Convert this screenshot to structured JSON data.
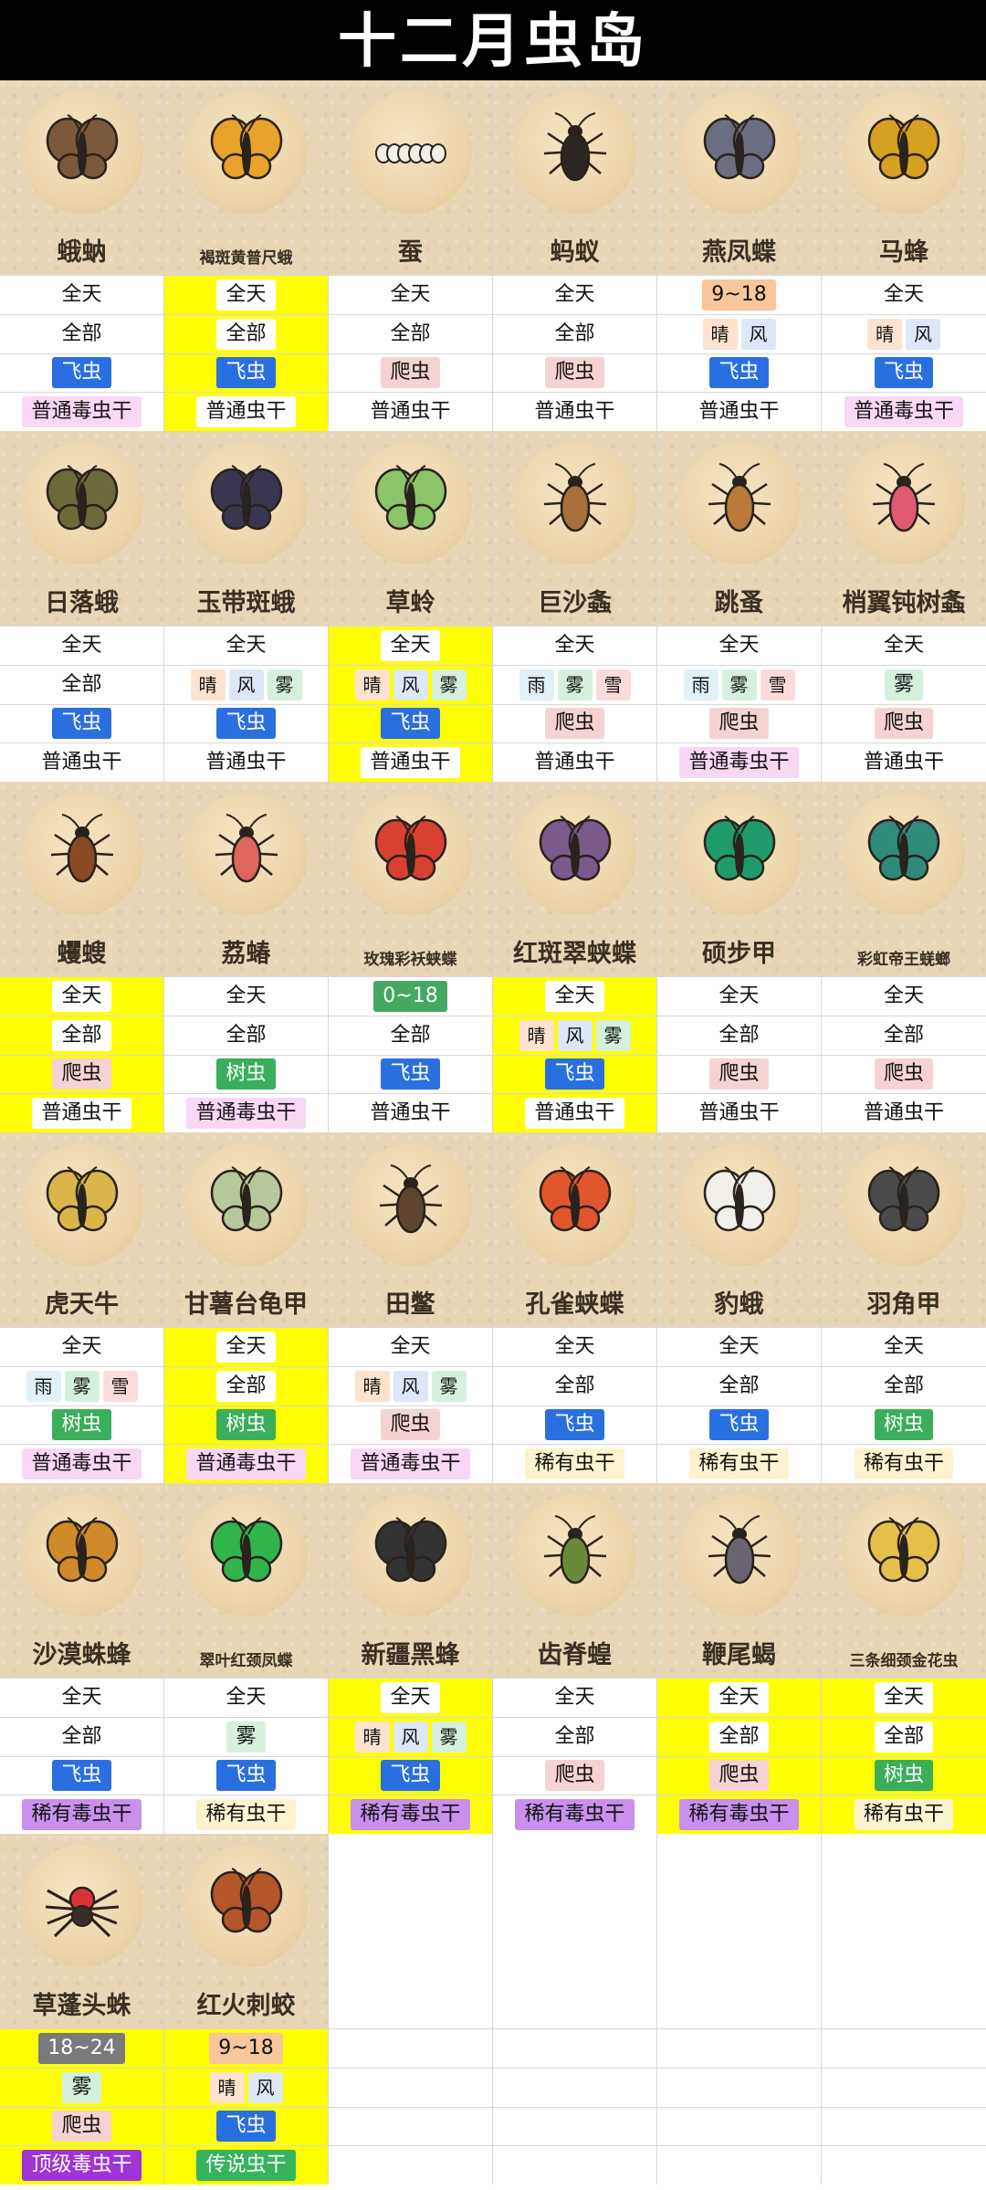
{
  "title": "十二月虫岛",
  "bugs": [
    {
      "name": "蛾蚋",
      "time": "全天",
      "weather": [
        {
          "label": "全部",
          "kind": "all"
        }
      ],
      "type": {
        "label": "飞虫",
        "kind": "fly"
      },
      "reward": {
        "label": "普通毒虫干",
        "kind": "ptox"
      },
      "highlight": false,
      "icon": "moth-fly-icon",
      "color": "#7a5a3a",
      "small": false
    },
    {
      "name": "褐斑黄普尺蛾",
      "time": "全天",
      "weather": [
        {
          "label": "全部",
          "kind": "all"
        }
      ],
      "type": {
        "label": "飞虫",
        "kind": "fly"
      },
      "reward": {
        "label": "普通虫干",
        "kind": "plain"
      },
      "highlight": true,
      "icon": "geometer-moth-icon",
      "color": "#e9a22a",
      "small": true
    },
    {
      "name": "蚕",
      "time": "全天",
      "weather": [
        {
          "label": "全部",
          "kind": "all"
        }
      ],
      "type": {
        "label": "爬虫",
        "kind": "crawl"
      },
      "reward": {
        "label": "普通虫干",
        "kind": "plain"
      },
      "highlight": false,
      "icon": "silkworm-icon",
      "color": "#f2efe6",
      "small": false
    },
    {
      "name": "蚂蚁",
      "time": "全天",
      "weather": [
        {
          "label": "全部",
          "kind": "all"
        }
      ],
      "type": {
        "label": "爬虫",
        "kind": "crawl"
      },
      "reward": {
        "label": "普通虫干",
        "kind": "plain"
      },
      "highlight": false,
      "icon": "ant-icon",
      "color": "#2b2622",
      "small": false
    },
    {
      "name": "燕凤蝶",
      "time": "9~18",
      "timeKind": "or",
      "weather": [
        {
          "label": "晴",
          "kind": "sun"
        },
        {
          "label": "风",
          "kind": "wind"
        }
      ],
      "type": {
        "label": "飞虫",
        "kind": "fly"
      },
      "reward": {
        "label": "普通虫干",
        "kind": "plain"
      },
      "highlight": false,
      "icon": "swallowtail-butterfly-icon",
      "color": "#6b6e80",
      "small": false
    },
    {
      "name": "马蜂",
      "time": "全天",
      "weather": [
        {
          "label": "晴",
          "kind": "sun"
        },
        {
          "label": "风",
          "kind": "wind"
        }
      ],
      "type": {
        "label": "飞虫",
        "kind": "fly"
      },
      "reward": {
        "label": "普通毒虫干",
        "kind": "ptox"
      },
      "highlight": false,
      "icon": "wasp-icon",
      "color": "#d6a021",
      "small": false
    },
    {
      "name": "日落蛾",
      "time": "全天",
      "weather": [
        {
          "label": "全部",
          "kind": "all"
        }
      ],
      "type": {
        "label": "飞虫",
        "kind": "fly"
      },
      "reward": {
        "label": "普通虫干",
        "kind": "plain"
      },
      "highlight": false,
      "icon": "sunset-moth-icon",
      "color": "#6b6a3a",
      "small": false
    },
    {
      "name": "玉带斑蛾",
      "time": "全天",
      "weather": [
        {
          "label": "晴",
          "kind": "sun"
        },
        {
          "label": "风",
          "kind": "wind"
        },
        {
          "label": "雾",
          "kind": "fog"
        }
      ],
      "type": {
        "label": "飞虫",
        "kind": "fly"
      },
      "reward": {
        "label": "普通虫干",
        "kind": "plain"
      },
      "highlight": false,
      "icon": "burnet-moth-icon",
      "color": "#3b3650",
      "small": false
    },
    {
      "name": "草蛉",
      "time": "全天",
      "weather": [
        {
          "label": "晴",
          "kind": "sun"
        },
        {
          "label": "风",
          "kind": "wind"
        },
        {
          "label": "雾",
          "kind": "fog"
        }
      ],
      "type": {
        "label": "飞虫",
        "kind": "fly"
      },
      "reward": {
        "label": "普通虫干",
        "kind": "plain"
      },
      "highlight": true,
      "icon": "lacewing-icon",
      "color": "#8cc46a",
      "small": false
    },
    {
      "name": "巨沙螽",
      "time": "全天",
      "weather": [
        {
          "label": "雨",
          "kind": "rain"
        },
        {
          "label": "雾",
          "kind": "fog"
        },
        {
          "label": "雪",
          "kind": "snow"
        }
      ],
      "type": {
        "label": "爬虫",
        "kind": "crawl"
      },
      "reward": {
        "label": "普通虫干",
        "kind": "plain"
      },
      "highlight": false,
      "icon": "sand-cricket-icon",
      "color": "#a8703a",
      "small": false
    },
    {
      "name": "跳蚤",
      "time": "全天",
      "weather": [
        {
          "label": "雨",
          "kind": "rain"
        },
        {
          "label": "雾",
          "kind": "fog"
        },
        {
          "label": "雪",
          "kind": "snow"
        }
      ],
      "type": {
        "label": "爬虫",
        "kind": "crawl"
      },
      "reward": {
        "label": "普通毒虫干",
        "kind": "ptox"
      },
      "highlight": false,
      "icon": "flea-icon",
      "color": "#b97a3c",
      "small": false
    },
    {
      "name": "梢翼钝树螽",
      "time": "全天",
      "weather": [
        {
          "label": "雾",
          "kind": "fog"
        }
      ],
      "type": {
        "label": "爬虫",
        "kind": "crawl"
      },
      "reward": {
        "label": "普通虫干",
        "kind": "plain"
      },
      "highlight": false,
      "icon": "katydid-icon",
      "color": "#e25a72",
      "small": false
    },
    {
      "name": "蠼螋",
      "time": "全天",
      "weather": [
        {
          "label": "全部",
          "kind": "all"
        }
      ],
      "type": {
        "label": "爬虫",
        "kind": "crawl"
      },
      "reward": {
        "label": "普通虫干",
        "kind": "plain"
      },
      "highlight": true,
      "icon": "earwig-icon",
      "color": "#8a4a24",
      "small": false
    },
    {
      "name": "荔蝽",
      "time": "全天",
      "weather": [
        {
          "label": "全部",
          "kind": "all"
        }
      ],
      "type": {
        "label": "树虫",
        "kind": "tree"
      },
      "reward": {
        "label": "普通毒虫干",
        "kind": "ptox"
      },
      "highlight": false,
      "icon": "stink-bug-icon",
      "color": "#e0655c",
      "small": false
    },
    {
      "name": "玫瑰彩袄蛱蝶",
      "time": "0~18",
      "timeKind": "gr",
      "weather": [
        {
          "label": "全部",
          "kind": "all"
        }
      ],
      "type": {
        "label": "飞虫",
        "kind": "fly"
      },
      "reward": {
        "label": "普通虫干",
        "kind": "plain"
      },
      "highlight": false,
      "icon": "rose-butterfly-icon",
      "color": "#d8402f",
      "small": true
    },
    {
      "name": "红斑翠蛱蝶",
      "time": "全天",
      "weather": [
        {
          "label": "晴",
          "kind": "sun"
        },
        {
          "label": "风",
          "kind": "wind"
        },
        {
          "label": "雾",
          "kind": "fog"
        }
      ],
      "type": {
        "label": "飞虫",
        "kind": "fly"
      },
      "reward": {
        "label": "普通虫干",
        "kind": "plain"
      },
      "highlight": true,
      "icon": "admiral-butterfly-icon",
      "color": "#7a5a8a",
      "small": false
    },
    {
      "name": "硕步甲",
      "time": "全天",
      "weather": [
        {
          "label": "全部",
          "kind": "all"
        }
      ],
      "type": {
        "label": "爬虫",
        "kind": "crawl"
      },
      "reward": {
        "label": "普通虫干",
        "kind": "plain"
      },
      "highlight": false,
      "icon": "ground-beetle-icon",
      "color": "#1f9a6a",
      "small": false
    },
    {
      "name": "彩虹帝王蜣螂",
      "time": "全天",
      "weather": [
        {
          "label": "全部",
          "kind": "all"
        }
      ],
      "type": {
        "label": "爬虫",
        "kind": "crawl"
      },
      "reward": {
        "label": "普通虫干",
        "kind": "plain"
      },
      "highlight": false,
      "icon": "dung-beetle-icon",
      "color": "#2f8a7a",
      "small": true
    },
    {
      "name": "虎天牛",
      "time": "全天",
      "weather": [
        {
          "label": "雨",
          "kind": "rain"
        },
        {
          "label": "雾",
          "kind": "fog"
        },
        {
          "label": "雪",
          "kind": "snow"
        }
      ],
      "type": {
        "label": "树虫",
        "kind": "tree"
      },
      "reward": {
        "label": "普通毒虫干",
        "kind": "ptox"
      },
      "highlight": false,
      "icon": "longhorn-beetle-icon",
      "color": "#d9b64a",
      "small": false
    },
    {
      "name": "甘薯台龟甲",
      "time": "全天",
      "weather": [
        {
          "label": "全部",
          "kind": "all"
        }
      ],
      "type": {
        "label": "树虫",
        "kind": "tree"
      },
      "reward": {
        "label": "普通毒虫干",
        "kind": "ptox"
      },
      "highlight": true,
      "icon": "tortoise-beetle-icon",
      "color": "#b7c89a",
      "small": false
    },
    {
      "name": "田鳖",
      "time": "全天",
      "weather": [
        {
          "label": "晴",
          "kind": "sun"
        },
        {
          "label": "风",
          "kind": "wind"
        },
        {
          "label": "雾",
          "kind": "fog"
        }
      ],
      "type": {
        "label": "爬虫",
        "kind": "crawl"
      },
      "reward": {
        "label": "普通毒虫干",
        "kind": "ptox"
      },
      "highlight": false,
      "icon": "water-bug-icon",
      "color": "#5e4530",
      "small": false
    },
    {
      "name": "孔雀蛱蝶",
      "time": "全天",
      "weather": [
        {
          "label": "全部",
          "kind": "all"
        }
      ],
      "type": {
        "label": "飞虫",
        "kind": "fly"
      },
      "reward": {
        "label": "稀有虫干",
        "kind": "rare"
      },
      "highlight": false,
      "icon": "peacock-butterfly-icon",
      "color": "#e0552b",
      "small": false
    },
    {
      "name": "豹蛾",
      "time": "全天",
      "weather": [
        {
          "label": "全部",
          "kind": "all"
        }
      ],
      "type": {
        "label": "飞虫",
        "kind": "fly"
      },
      "reward": {
        "label": "稀有虫干",
        "kind": "rare"
      },
      "highlight": false,
      "icon": "leopard-moth-icon",
      "color": "#f1efe9",
      "small": false
    },
    {
      "name": "羽角甲",
      "time": "全天",
      "weather": [
        {
          "label": "全部",
          "kind": "all"
        }
      ],
      "type": {
        "label": "树虫",
        "kind": "tree"
      },
      "reward": {
        "label": "稀有虫干",
        "kind": "rare"
      },
      "highlight": false,
      "icon": "feather-horned-beetle-icon",
      "color": "#4a4a4a",
      "small": false
    },
    {
      "name": "沙漠蛛蜂",
      "time": "全天",
      "weather": [
        {
          "label": "全部",
          "kind": "all"
        }
      ],
      "type": {
        "label": "飞虫",
        "kind": "fly"
      },
      "reward": {
        "label": "稀有毒虫干",
        "kind": "rtox"
      },
      "highlight": false,
      "icon": "spider-wasp-icon",
      "color": "#d08a2a",
      "small": false
    },
    {
      "name": "翠叶红颈凤蝶",
      "time": "全天",
      "weather": [
        {
          "label": "雾",
          "kind": "fog"
        }
      ],
      "type": {
        "label": "飞虫",
        "kind": "fly"
      },
      "reward": {
        "label": "稀有虫干",
        "kind": "rare"
      },
      "highlight": false,
      "icon": "birdwing-butterfly-icon",
      "color": "#2fb54a",
      "small": true
    },
    {
      "name": "新疆黑蜂",
      "time": "全天",
      "weather": [
        {
          "label": "晴",
          "kind": "sun"
        },
        {
          "label": "风",
          "kind": "wind"
        },
        {
          "label": "雾",
          "kind": "fog"
        }
      ],
      "type": {
        "label": "飞虫",
        "kind": "fly"
      },
      "reward": {
        "label": "稀有毒虫干",
        "kind": "rtox"
      },
      "highlight": true,
      "icon": "black-bee-icon",
      "color": "#333333",
      "small": false
    },
    {
      "name": "齿脊蝗",
      "time": "全天",
      "weather": [
        {
          "label": "全部",
          "kind": "all"
        }
      ],
      "type": {
        "label": "爬虫",
        "kind": "crawl"
      },
      "reward": {
        "label": "稀有毒虫干",
        "kind": "rtox"
      },
      "highlight": false,
      "icon": "grasshopper-icon",
      "color": "#6a8a3a",
      "small": false
    },
    {
      "name": "鞭尾蝎",
      "time": "全天",
      "weather": [
        {
          "label": "全部",
          "kind": "all"
        }
      ],
      "type": {
        "label": "爬虫",
        "kind": "crawl"
      },
      "reward": {
        "label": "稀有毒虫干",
        "kind": "rtox"
      },
      "highlight": true,
      "icon": "whip-scorpion-icon",
      "color": "#6a6470",
      "small": false
    },
    {
      "name": "三条细颈金花虫",
      "time": "全天",
      "weather": [
        {
          "label": "全部",
          "kind": "all"
        }
      ],
      "type": {
        "label": "树虫",
        "kind": "tree"
      },
      "reward": {
        "label": "稀有虫干",
        "kind": "rare"
      },
      "highlight": true,
      "icon": "leaf-beetle-icon",
      "color": "#e4c04a",
      "small": true
    },
    {
      "name": "草蓬头蛛",
      "time": "18~24",
      "timeKind": "gy",
      "weather": [
        {
          "label": "雾",
          "kind": "fog"
        }
      ],
      "type": {
        "label": "爬虫",
        "kind": "crawl"
      },
      "reward": {
        "label": "顶级毒虫干",
        "kind": "top"
      },
      "highlight": true,
      "icon": "jumping-spider-icon",
      "color": "#d9333a",
      "small": false
    },
    {
      "name": "红火刺蛟",
      "time": "9~18",
      "timeKind": "or",
      "weather": [
        {
          "label": "晴",
          "kind": "sun"
        },
        {
          "label": "风",
          "kind": "wind"
        }
      ],
      "type": {
        "label": "飞虫",
        "kind": "fly"
      },
      "reward": {
        "label": "传说虫干",
        "kind": "leg"
      },
      "highlight": true,
      "icon": "fire-fly-icon",
      "color": "#b4552a",
      "small": false
    }
  ]
}
